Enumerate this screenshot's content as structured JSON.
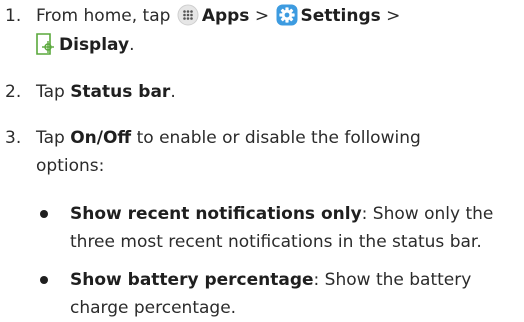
{
  "steps": [
    {
      "number": "1.",
      "line1_prefix": "From home, tap",
      "apps_label": "Apps",
      "settings_label": "Settings",
      "display_label": "Display",
      "separator": ">",
      "end": "."
    },
    {
      "number": "2.",
      "prefix": "Tap",
      "bold": "Status bar",
      "end": "."
    },
    {
      "number": "3.",
      "prefix": "Tap",
      "bold": "On/Off",
      "rest_line1": "to enable or disable the following",
      "rest_line2": "options:"
    }
  ],
  "bullets": [
    {
      "title": "Show recent notifications only",
      "line1_rest": ": Show only the",
      "line2": "three most recent notifications in the status bar."
    },
    {
      "title": "Show battery percentage",
      "line1_rest": ": Show the battery",
      "line2": "charge percentage."
    }
  ],
  "colors": {
    "apps_icon_bg": "#e6e6e6",
    "settings_icon_bg": "#3d9be0",
    "display_icon": "#5aa83c"
  }
}
